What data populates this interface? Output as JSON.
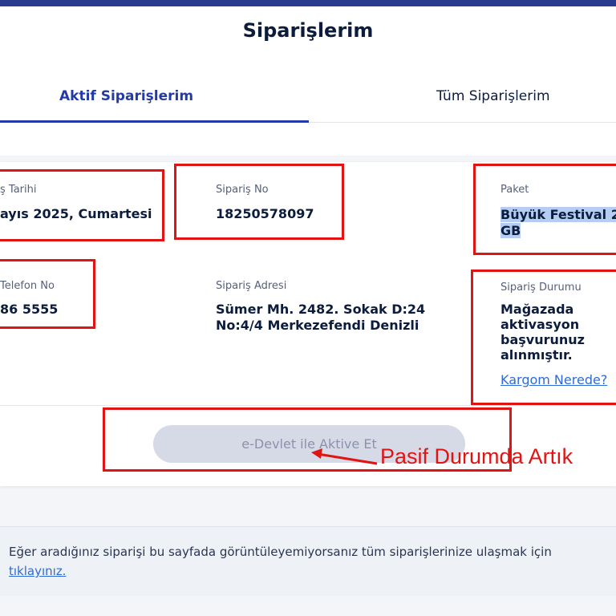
{
  "header": {
    "title": "Siparişlerim"
  },
  "tabs": [
    {
      "label": "Aktif Siparişlerim",
      "active": true
    },
    {
      "label": "Tüm Siparişlerim",
      "active": false
    }
  ],
  "order": {
    "date_label": "ş Tarihi",
    "date_value": "ayıs 2025, Cumartesi",
    "order_no_label": "Sipariş No",
    "order_no_value": "18250578097",
    "package_label": "Paket",
    "package_value_line1": "Büyük Festival 2",
    "package_value_line2": "GB",
    "phone_label": "Telefon No",
    "phone_value": "86 5555",
    "address_label": "Sipariş Adresi",
    "address_value": "Sümer Mh. 2482. Sokak D:24 No:4/4 Merkezefendi Denizli",
    "status_label": "Sipariş Durumu",
    "status_value": "Mağazada aktivasyon başvurunuz alınmıştır.",
    "tracking_link": "Kargom Nerede?"
  },
  "actions": {
    "activate_button": "e-Devlet ile Aktive Et",
    "activate_button_state": "disabled"
  },
  "annotation": {
    "text": "Pasif Durumda Artık",
    "color": "#e11414"
  },
  "info": {
    "text": "Eğer aradığınız siparişi bu sayfada görüntüleyemiyorsanız tüm siparişlerinize ulaşmak için",
    "link": "tıklayınız."
  },
  "colors": {
    "brand": "#243aa6",
    "topbar": "#2a3b8f",
    "link": "#2f6bd8",
    "annotation_red": "#e11414"
  }
}
